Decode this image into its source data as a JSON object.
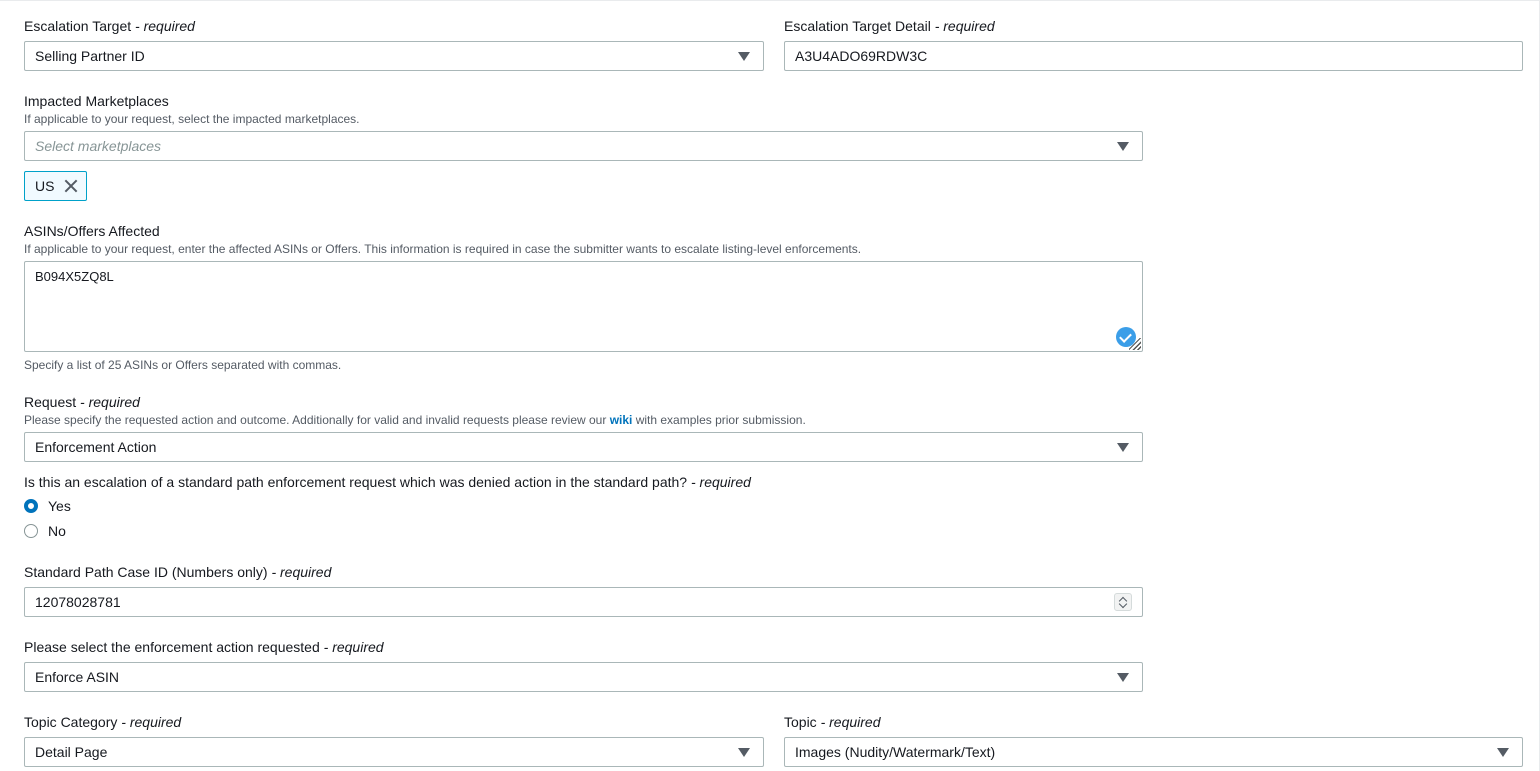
{
  "escalation_target": {
    "label": "Escalation Target",
    "required": " - required",
    "value": "Selling Partner ID"
  },
  "escalation_target_detail": {
    "label": "Escalation Target Detail",
    "required": " - required",
    "value": "A3U4ADO69RDW3C"
  },
  "impacted_marketplaces": {
    "label": "Impacted Marketplaces",
    "description": "If applicable to your request, select the impacted marketplaces.",
    "placeholder": "Select marketplaces",
    "tokens": [
      "US"
    ]
  },
  "asins": {
    "label": "ASINs/Offers Affected",
    "description": "If applicable to your request, enter the affected ASINs or Offers. This information is required in case the submitter wants to escalate listing-level enforcements.",
    "value": "B094X5ZQ8L",
    "constraint": "Specify a list of 25 ASINs or Offers separated with commas."
  },
  "request": {
    "label": "Request",
    "required": " - required",
    "description_before": "Please specify the requested action and outcome. Additionally for valid and invalid requests please review our ",
    "link": "wiki",
    "description_after": " with examples prior submission.",
    "value": "Enforcement Action"
  },
  "escalation_question": {
    "label": "Is this an escalation of a standard path enforcement request which was denied action in the standard path?",
    "required": " - required",
    "options": [
      "Yes",
      "No"
    ],
    "selected": "Yes"
  },
  "case_id": {
    "label": "Standard Path Case ID (Numbers only)",
    "required": " - required",
    "value": "12078028781"
  },
  "enforcement_action": {
    "label": "Please select the enforcement action requested",
    "required": " - required",
    "value": "Enforce ASIN"
  },
  "topic_category": {
    "label": "Topic Category",
    "required": " - required",
    "value": "Detail Page"
  },
  "topic": {
    "label": "Topic",
    "required": " - required",
    "value": "Images (Nudity/Watermark/Text)"
  },
  "colors": {
    "link": "#0073bb",
    "radio_selected": "#0073bb",
    "token_border": "#00a1c9"
  }
}
